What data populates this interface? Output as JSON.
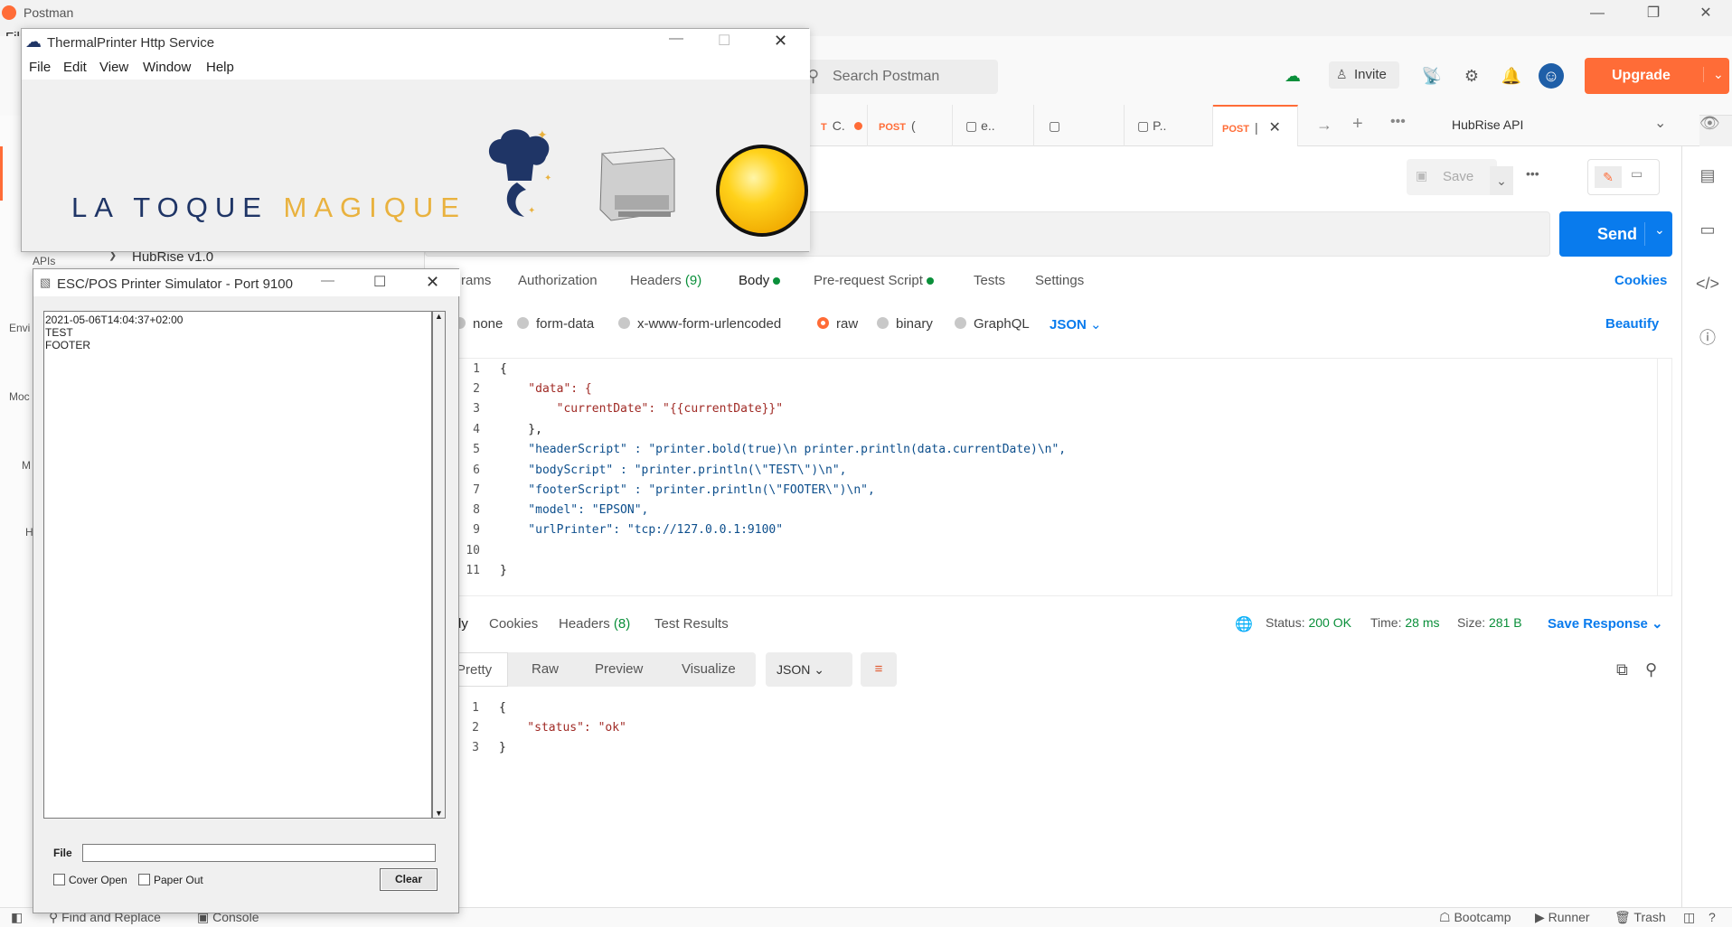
{
  "titlebar": {
    "app_title": "Postman",
    "minimize": "—",
    "restore": "❐",
    "close": "✕"
  },
  "header": {
    "search_placeholder": "Search Postman",
    "invite_label": "Invite",
    "upgrade_label": "Upgrade",
    "file_fragment": "Fil"
  },
  "tabs": {
    "items": [
      {
        "method": "T",
        "label": "C.",
        "dot": true
      },
      {
        "method": "POST",
        "label": "("
      },
      {
        "method": "",
        "label": "e.."
      },
      {
        "method": "",
        "label": ""
      },
      {
        "method": "",
        "label": "P.."
      },
      {
        "method": "POST",
        "label": "|"
      }
    ],
    "environment": "HubRise API"
  },
  "request": {
    "save_label": "Save",
    "send_label": "Send",
    "subtabs": [
      "rams",
      "Authorization",
      "Headers",
      "Body",
      "Pre-request Script",
      "Tests",
      "Settings"
    ],
    "headers_count": "(9)",
    "cookies_label": "Cookies",
    "body_types": [
      "none",
      "form-data",
      "x-www-form-urlencoded",
      "raw",
      "binary",
      "GraphQL"
    ],
    "body_format": "JSON",
    "beautify_label": "Beautify"
  },
  "editor": {
    "line_numbers": [
      "1",
      "2",
      "3",
      "4",
      "5",
      "6",
      "7",
      "8",
      "9",
      "10",
      "11"
    ],
    "lines": [
      "{",
      "    \"data\": {",
      "        \"currentDate\": \"{{currentDate}}\"",
      "    },",
      "    \"headerScript\" : \"printer.bold(true)\\n printer.println(data.currentDate)\\n\",",
      "    \"bodyScript\" : \"printer.println(\\\"TEST\\\")\\n\",",
      "    \"footerScript\" : \"printer.println(\\\"FOOTER\\\")\\n\",",
      "    \"model\": \"EPSON\",",
      "    \"urlPrinter\": \"tcp://127.0.0.1:9100\"",
      "",
      "}"
    ]
  },
  "response": {
    "tabs": [
      "dy",
      "Cookies",
      "Headers",
      "Test Results"
    ],
    "headers_count": "(8)",
    "status_label": "Status:",
    "status_value": "200 OK",
    "time_label": "Time:",
    "time_value": "28 ms",
    "size_label": "Size:",
    "size_value": "281 B",
    "save_response": "Save Response",
    "view_modes": [
      "Pretty",
      "Raw",
      "Preview",
      "Visualize"
    ],
    "format": "JSON",
    "line_numbers": [
      "1",
      "2",
      "3"
    ],
    "lines": [
      "{",
      "    \"status\": \"ok\"",
      "}"
    ]
  },
  "sidebar": {
    "labels": [
      "APIs",
      "Envi",
      "Moc",
      "M",
      "H"
    ],
    "tree_item": "HubRise v1.0"
  },
  "statusbar": {
    "find_replace": "Find and Replace",
    "console": "Console",
    "bootcamp": "Bootcamp",
    "runner": "Runner",
    "trash": "Trash"
  },
  "thermal": {
    "title": "ThermalPrinter Http Service",
    "menu": [
      "File",
      "Edit",
      "View",
      "Window",
      "Help"
    ],
    "brand_left": "LA TOQUE ",
    "brand_right": "MAGIQUE",
    "brand_navy": "#1f3566",
    "brand_gold": "#e9b23f"
  },
  "escpos": {
    "title": "ESC/POS Printer Simulator - Port 9100",
    "output_lines": [
      "2021-05-06T14:04:37+02:00",
      "TEST",
      "FOOTER"
    ],
    "file_label": "File",
    "cover_open": "Cover Open",
    "paper_out": "Paper Out",
    "clear_label": "Clear"
  }
}
